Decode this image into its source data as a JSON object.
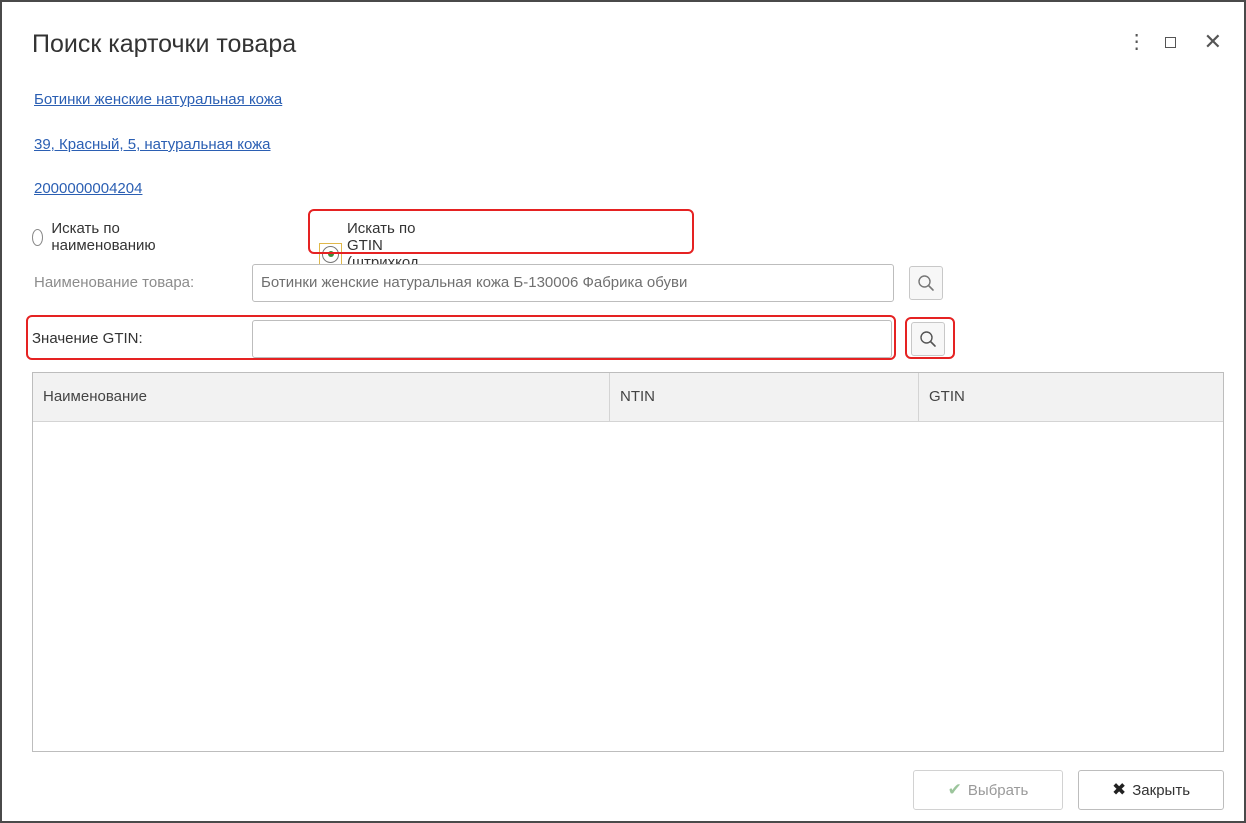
{
  "window": {
    "title": "Поиск карточки товара",
    "more_glyph": "⋮",
    "close_glyph": "✕"
  },
  "links": {
    "product": "Ботинки женские натуральная кожа",
    "characteristic": "39, Красный, 5, натуральная кожа",
    "barcode": "2000000004204"
  },
  "search_mode": {
    "option_name": "Искать по наименованию",
    "option_gtin": "Искать по GTIN (штрихкод товара)",
    "selected": "gtin"
  },
  "name_field": {
    "label": "Наименование товара:",
    "value": "Ботинки женские натуральная кожа Б-130006 Фабрика обуви"
  },
  "gtin_field": {
    "label": "Значение GTIN:",
    "value": ""
  },
  "table": {
    "columns": [
      "Наименование",
      "NTIN",
      "GTIN"
    ],
    "rows": []
  },
  "buttons": {
    "select": "Выбрать",
    "select_icon": "✔",
    "close": "Закрыть",
    "close_icon": "✖"
  },
  "colors": {
    "link": "#2b5fb3",
    "highlight": "#e52222",
    "radio_dot": "#3a8a3a"
  }
}
